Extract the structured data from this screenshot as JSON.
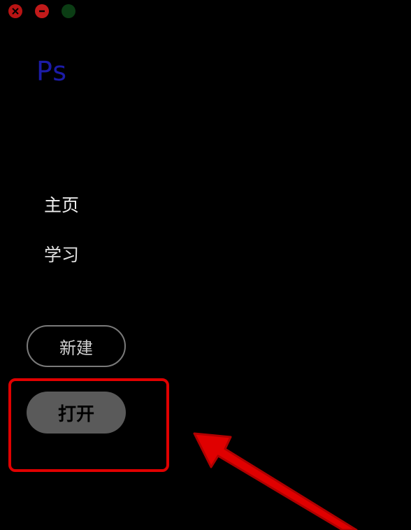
{
  "window_controls": {
    "close_icon": "close-icon",
    "minimize_icon": "minimize-icon",
    "maximize_icon": "maximize-icon"
  },
  "app": {
    "logo_text": "Ps",
    "logo_color": "#1c1ca8"
  },
  "nav": {
    "home_label": "主页",
    "learn_label": "学习"
  },
  "actions": {
    "new_label": "新建",
    "open_label": "打开"
  },
  "annotation": {
    "highlight_color": "#e00000",
    "arrow_color": "#e00000"
  }
}
